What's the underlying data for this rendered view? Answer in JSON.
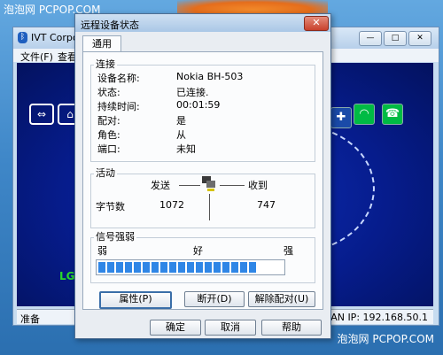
{
  "watermark": {
    "top": "泡泡网 PCPOP.COM",
    "bottom": "泡泡网 PCPOP.COM"
  },
  "ivt_window": {
    "title": "IVT Corpo",
    "menu": [
      "文件(F)",
      "查看"
    ],
    "status_left": "准备",
    "status_right": "AN IP: 192.168.50.1",
    "device_label": "LG",
    "controls": {
      "minimize": "—",
      "maximize": "□",
      "close": "✕"
    }
  },
  "dialog": {
    "title": "远程设备状态",
    "close_glyph": "✕",
    "tab": "通用",
    "connection": {
      "heading": "连接",
      "rows": [
        {
          "label": "设备名称:",
          "value": "Nokia BH-503"
        },
        {
          "label": "状态:",
          "value": "已连接."
        },
        {
          "label": "持续时间:",
          "value": "00:01:59"
        },
        {
          "label": "配对:",
          "value": "是"
        },
        {
          "label": "角色:",
          "value": "从"
        },
        {
          "label": "端口:",
          "value": "未知"
        }
      ]
    },
    "activity": {
      "heading": "活动",
      "sent_label": "发送",
      "received_label": "收到",
      "bytes_label": "字节数",
      "sent_bytes": "1072",
      "received_bytes": "747"
    },
    "signal": {
      "heading": "信号强弱",
      "weak": "弱",
      "good": "好",
      "strong": "强",
      "level": 0.87
    },
    "buttons": {
      "properties": "属性(P)",
      "disconnect": "断开(D)",
      "unpair": "解除配对(U)",
      "ok": "确定",
      "cancel": "取消",
      "help": "帮助"
    }
  },
  "colors": {
    "signal_fill": "#2f86e6",
    "desktop": "#3f87c8"
  }
}
